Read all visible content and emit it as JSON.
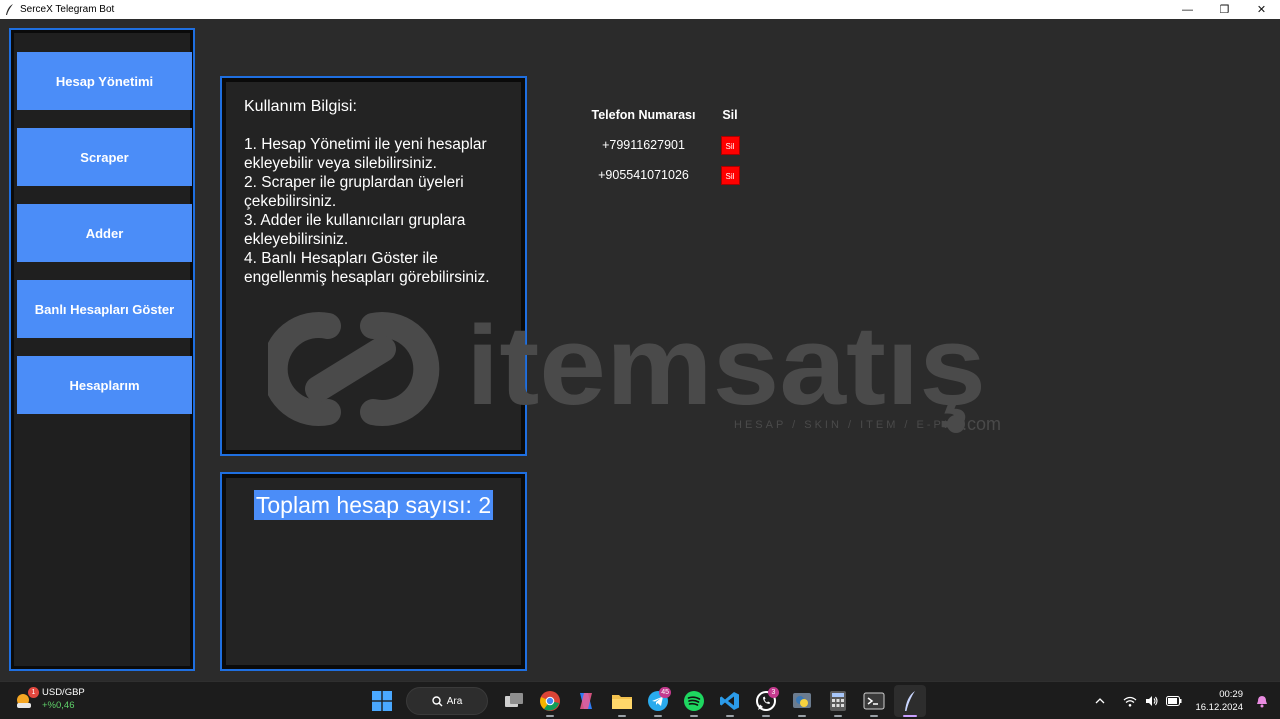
{
  "window": {
    "title": "SerceX Telegram Bot",
    "minimize_glyph": "—",
    "restore_glyph": "❐",
    "close_glyph": "✕"
  },
  "sidebar": {
    "items": [
      {
        "label": "Hesap Yönetimi"
      },
      {
        "label": "Scraper"
      },
      {
        "label": "Adder"
      },
      {
        "label": "Banlı Hesapları Göster"
      },
      {
        "label": "Hesaplarım"
      }
    ]
  },
  "info": {
    "heading": "Kullanım Bilgisi:",
    "lines": [
      "1. Hesap Yönetimi ile yeni hesaplar",
      "ekleyebilir veya silebilirsiniz.",
      "2. Scraper ile gruplardan üyeleri",
      "çekebilirsiniz.",
      "3. Adder ile kullanıcıları gruplara",
      "ekleyebilirsiniz.",
      "4. Banlı Hesapları Göster ile",
      "engellenmiş hesapları görebilirsiniz."
    ]
  },
  "count": {
    "label": "Toplam hesap sayısı: 2"
  },
  "accounts": {
    "header_phone": "Telefon Numarası",
    "header_delete": "Sil",
    "rows": [
      {
        "phone": "+79911627901",
        "delete_label": "Sil"
      },
      {
        "phone": "+905541071026",
        "delete_label": "Sil"
      }
    ]
  },
  "watermark": {
    "brand": "itemsatış",
    "tagline": "HESAP / SKIN / ITEM / E-PIN",
    "suffix": ".com"
  },
  "taskbar": {
    "weather_title": "USD/GBP",
    "weather_change": "+%0,46",
    "weather_badge": "1",
    "search_label": "Ara",
    "telegram_badge": "45",
    "whatsapp_badge": "3",
    "time": "00:29",
    "date": "16.12.2024"
  },
  "colors": {
    "accent": "#4b8df8",
    "border": "#1f6fe0",
    "delete": "#ff0000",
    "background": "#2b2b2b"
  }
}
